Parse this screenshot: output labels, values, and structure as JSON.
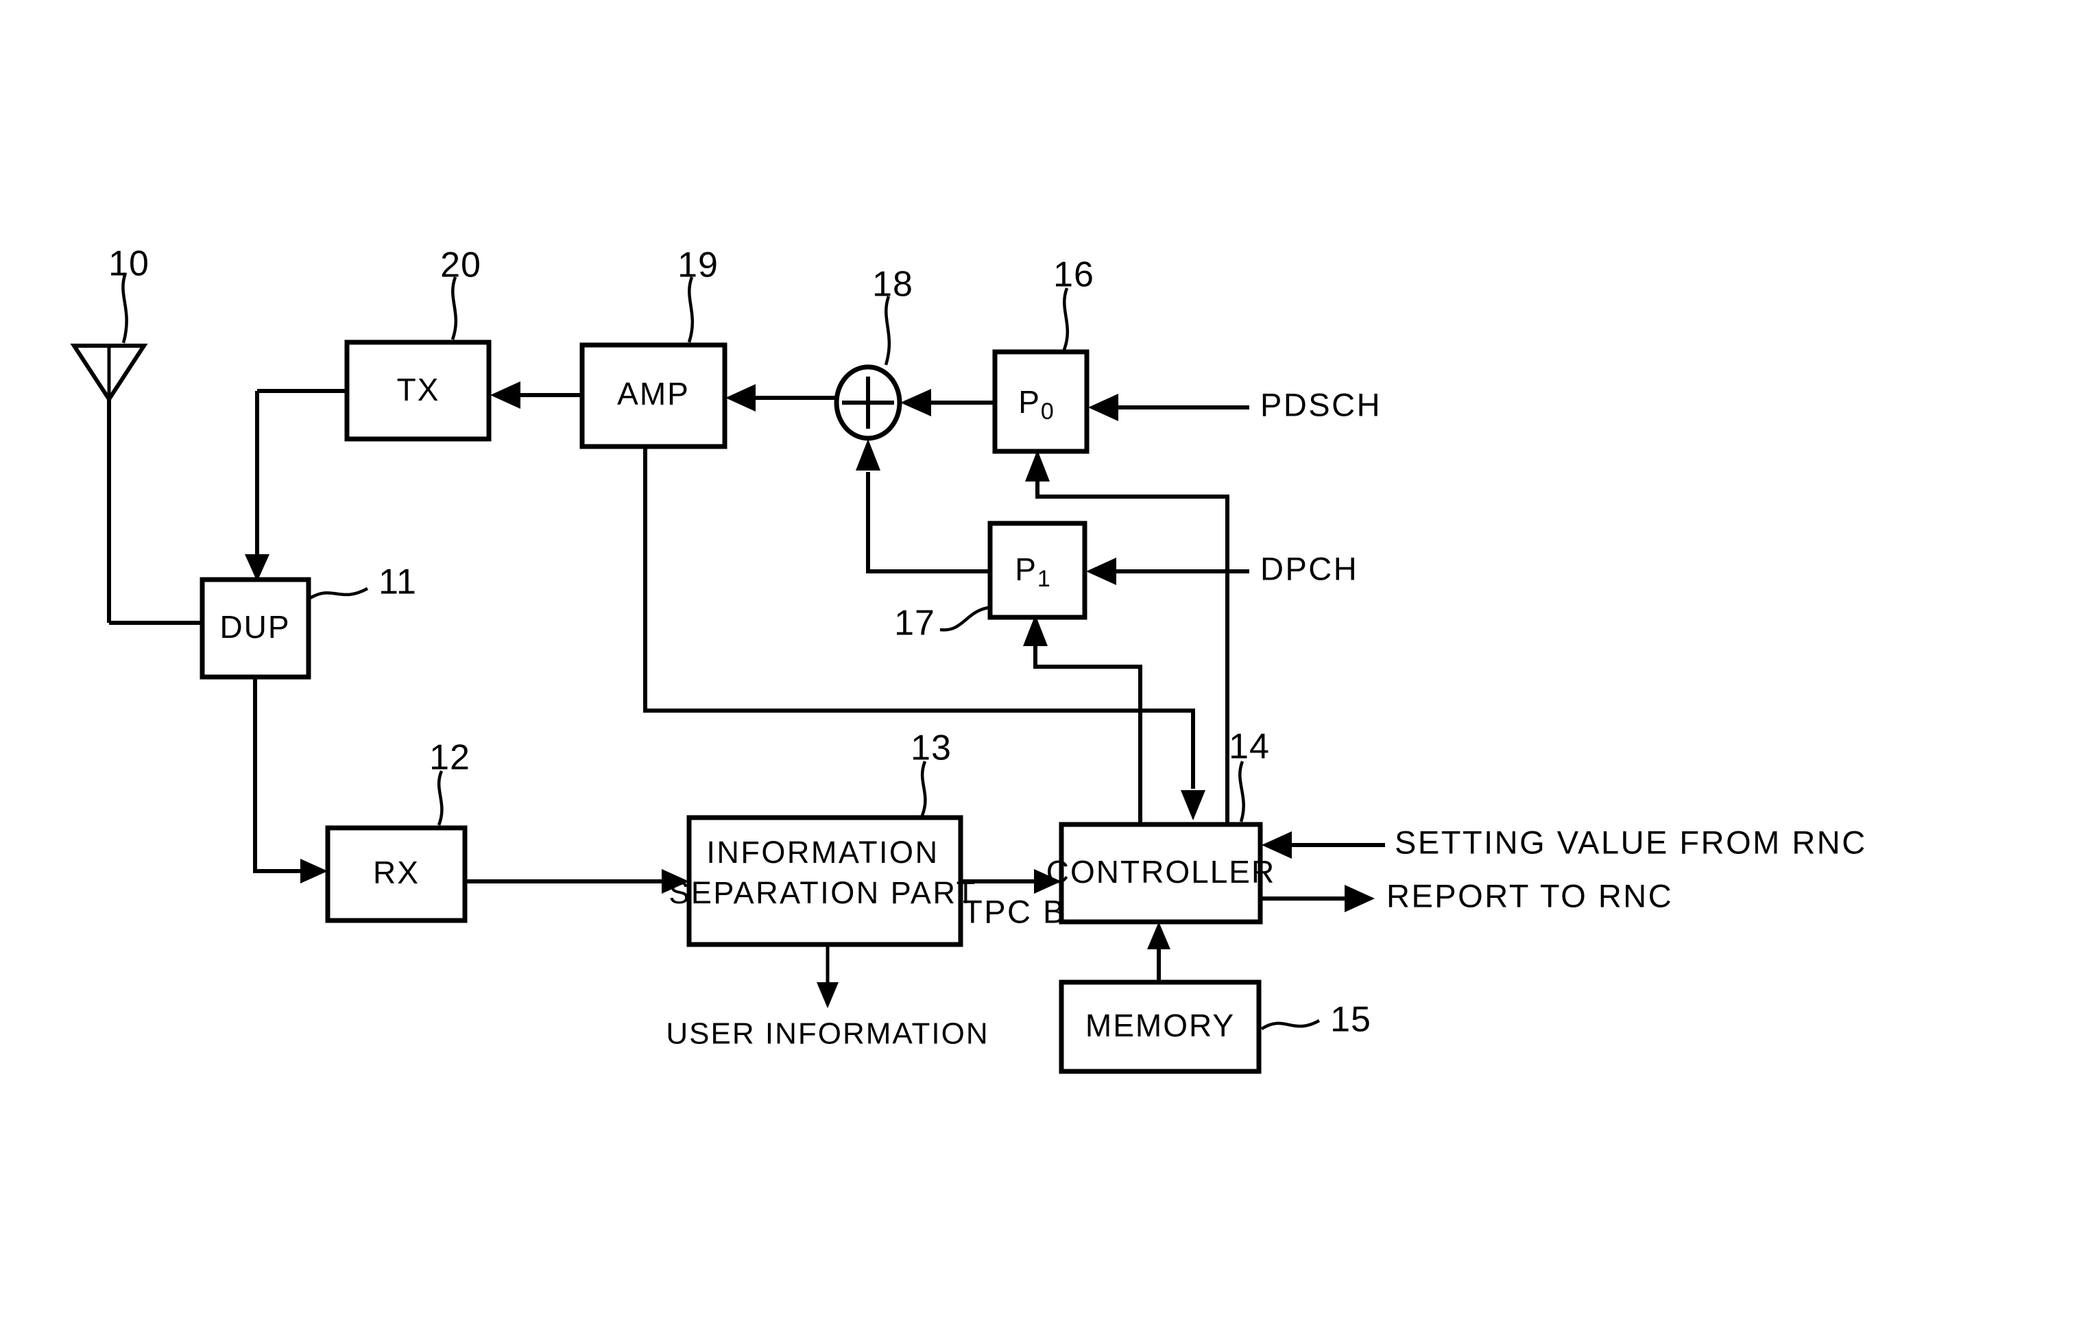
{
  "figure": {
    "type": "patent-block-diagram",
    "title": "",
    "background_color": "#ffffff",
    "line_color": "#000000"
  },
  "blocks": [
    {
      "id": "antenna",
      "label": "",
      "ref": "10"
    },
    {
      "id": "dup",
      "label": "DUP",
      "ref": "11"
    },
    {
      "id": "rx",
      "label": "RX",
      "ref": "12"
    },
    {
      "id": "infosep",
      "label": "INFORMATION",
      "label2": "SEPARATION PART",
      "ref": "13"
    },
    {
      "id": "controller",
      "label": "CONTROLLER",
      "ref": "14"
    },
    {
      "id": "memory",
      "label": "MEMORY",
      "ref": "15"
    },
    {
      "id": "p0",
      "label": "P",
      "sub": "0",
      "ref": "16"
    },
    {
      "id": "p1",
      "label": "P",
      "sub": "1",
      "ref": "17"
    },
    {
      "id": "adder",
      "label": "+",
      "ref": "18"
    },
    {
      "id": "amp",
      "label": "AMP",
      "ref": "19"
    },
    {
      "id": "tx",
      "label": "TX",
      "ref": "20"
    }
  ],
  "signals": {
    "pdsch": "PDSCH",
    "dpch": "DPCH",
    "tpc_bit": "TPC BIT",
    "user_information": "USER INFORMATION",
    "setting_value_from_rnc": "SETTING VALUE FROM RNC",
    "report_to_rnc": "REPORT TO RNC"
  },
  "refs": {
    "r10": "10",
    "r11": "11",
    "r12": "12",
    "r13": "13",
    "r14": "14",
    "r15": "15",
    "r16": "16",
    "r17": "17",
    "r18": "18",
    "r19": "19",
    "r20": "20"
  },
  "labels": {
    "dup": "DUP",
    "rx": "RX",
    "tx": "TX",
    "amp": "AMP",
    "adder": "+",
    "p0_main": "P",
    "p0_sub": "0",
    "p1_main": "P",
    "p1_sub": "1",
    "controller": "CONTROLLER",
    "memory": "MEMORY",
    "infosep_line1": "INFORMATION",
    "infosep_line2": "SEPARATION PART"
  }
}
